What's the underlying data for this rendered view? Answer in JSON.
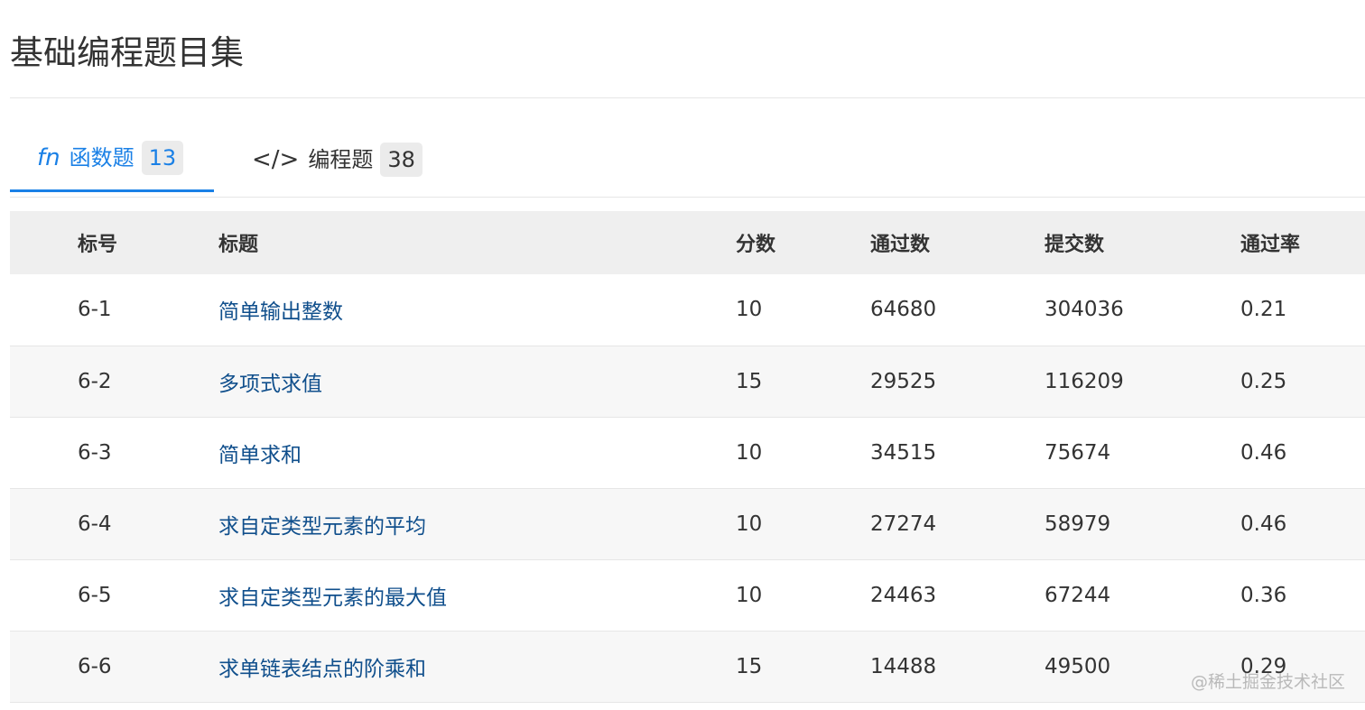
{
  "page": {
    "title": "基础编程题目集"
  },
  "tabs": [
    {
      "icon": "function-icon",
      "glyph": "fn",
      "label": "函数题",
      "count": "13",
      "active": true
    },
    {
      "icon": "code-icon",
      "glyph": "</>",
      "label": "编程题",
      "count": "38",
      "active": false
    }
  ],
  "table": {
    "headers": {
      "no": "标号",
      "title": "标题",
      "score": "分数",
      "passed": "通过数",
      "submitted": "提交数",
      "rate": "通过率"
    },
    "rows": [
      {
        "no": "6-1",
        "title": "简单输出整数",
        "score": "10",
        "passed": "64680",
        "submitted": "304036",
        "rate": "0.21"
      },
      {
        "no": "6-2",
        "title": "多项式求值",
        "score": "15",
        "passed": "29525",
        "submitted": "116209",
        "rate": "0.25"
      },
      {
        "no": "6-3",
        "title": "简单求和",
        "score": "10",
        "passed": "34515",
        "submitted": "75674",
        "rate": "0.46"
      },
      {
        "no": "6-4",
        "title": "求自定类型元素的平均",
        "score": "10",
        "passed": "27274",
        "submitted": "58979",
        "rate": "0.46"
      },
      {
        "no": "6-5",
        "title": "求自定类型元素的最大值",
        "score": "10",
        "passed": "24463",
        "submitted": "67244",
        "rate": "0.36"
      },
      {
        "no": "6-6",
        "title": "求单链表结点的阶乘和",
        "score": "15",
        "passed": "14488",
        "submitted": "49500",
        "rate": "0.29"
      }
    ]
  },
  "watermark": "@稀土掘金技术社区",
  "colors": {
    "accent": "#1a80e6",
    "link": "#104f8c",
    "header_bg": "#efefef",
    "stripe_bg": "#f7f7f7"
  }
}
